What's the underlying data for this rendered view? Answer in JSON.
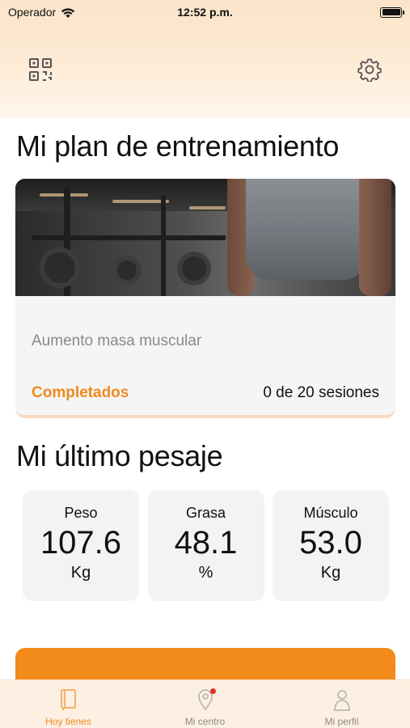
{
  "status_bar": {
    "carrier": "Operador",
    "time": "12:52 p.m."
  },
  "header": {
    "qr_icon": "qr-code-icon",
    "settings_icon": "gear-icon"
  },
  "plan": {
    "section_title": "Mi plan de entrenamiento",
    "name": "Aumento masa muscular",
    "completed_label": "Completados",
    "sessions": "0 de 20 sesiones"
  },
  "weigh_in": {
    "section_title": "Mi último pesaje",
    "metrics": [
      {
        "label": "Peso",
        "value": "107.6",
        "unit": "Kg"
      },
      {
        "label": "Grasa",
        "value": "48.1",
        "unit": "%"
      },
      {
        "label": "Músculo",
        "value": "53.0",
        "unit": "Kg"
      }
    ]
  },
  "tabs": [
    {
      "label": "Hoy tienes",
      "icon": "book-icon",
      "active": true
    },
    {
      "label": "Mi centro",
      "icon": "location-pin-icon",
      "active": false,
      "notification": true
    },
    {
      "label": "Mi perfil",
      "icon": "person-icon",
      "active": false
    }
  ],
  "colors": {
    "accent": "#ef8a1e",
    "cta": "#f28a1c",
    "header_gradient": "#fbe4c9",
    "notification": "#e0302a"
  }
}
